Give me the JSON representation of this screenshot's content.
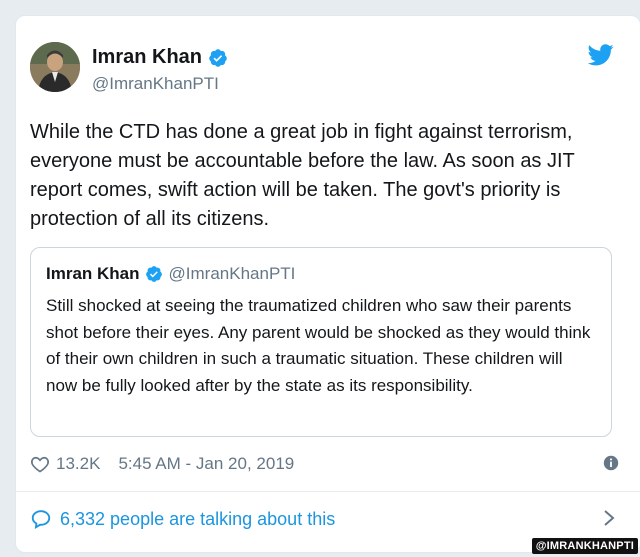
{
  "author": {
    "name": "Imran Khan",
    "handle": "@ImranKhanPTI",
    "avatar_icon": "avatar-portrait",
    "verified_icon": "verified-badge-icon"
  },
  "tweet": {
    "text": "While the CTD has done a great job in fight against terrorism, everyone must be accountable before the law. As soon as JIT report comes, swift action will be taken. The govt's priority is protection of all its citizens.",
    "likes": "13.2K",
    "timestamp": "5:45 AM - Jan 20, 2019"
  },
  "quoted_tweet": {
    "name": "Imran Khan",
    "handle": "@ImranKhanPTI",
    "text": "Still shocked at seeing the traumatized children who saw their parents shot before their eyes. Any parent would be shocked as they would think of their own children in such a traumatic situation. These children will now be fully looked after by the state as its responsibility."
  },
  "footer": {
    "talking": "6,332 people are talking about this"
  },
  "watermark": "@IMRANKHANPTI",
  "colors": {
    "accent": "#1da1f2",
    "link": "#1b95e0",
    "secondary_text": "#657786"
  }
}
